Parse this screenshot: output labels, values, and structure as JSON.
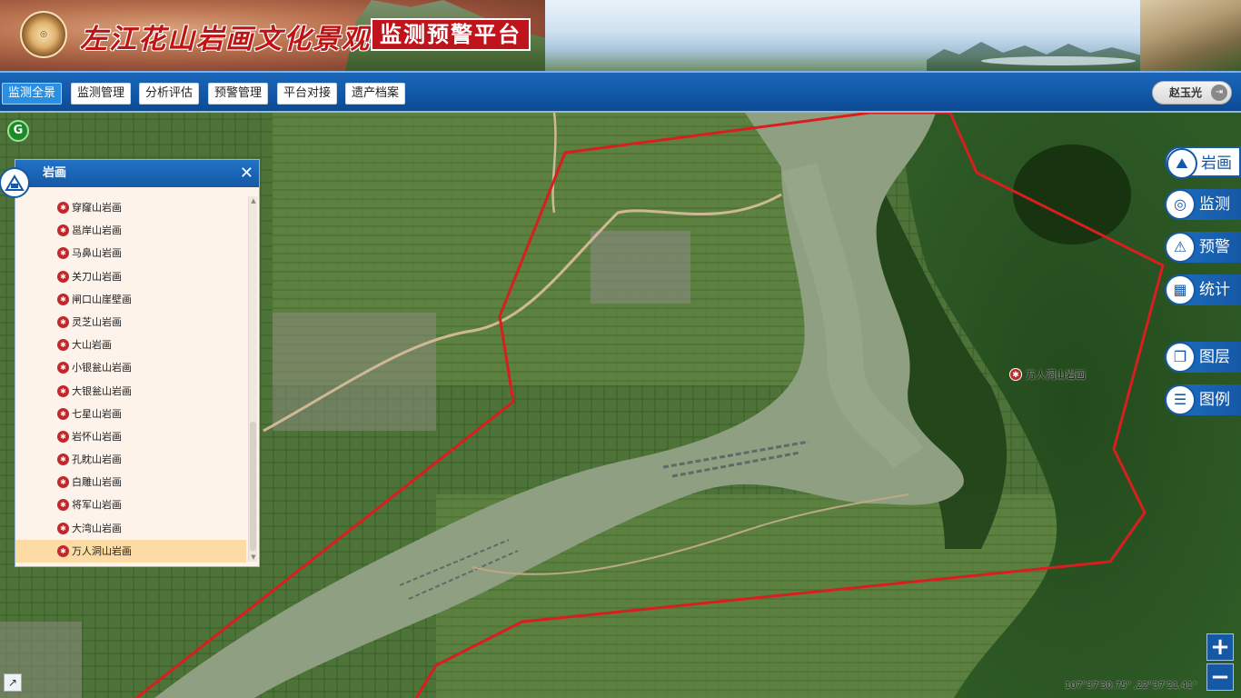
{
  "header": {
    "site_title": "左江花山岩画文化景观",
    "platform_title": "监测预警平台"
  },
  "nav": {
    "items": [
      "监测全景",
      "监测管理",
      "分析评估",
      "预警管理",
      "平台对接",
      "遗产档案"
    ],
    "active": "监测全景",
    "user_name": "赵玉光"
  },
  "panel": {
    "title": "岩画",
    "close_label": "✕",
    "items": [
      {
        "name": "穿窿山岩画"
      },
      {
        "name": "邕岸山岩画"
      },
      {
        "name": "马鼻山岩画"
      },
      {
        "name": "关刀山岩画"
      },
      {
        "name": "闸口山崖壁画"
      },
      {
        "name": "灵芝山岩画"
      },
      {
        "name": "大山岩画"
      },
      {
        "name": "小银瓮山岩画"
      },
      {
        "name": "大银瓮山岩画"
      },
      {
        "name": "七星山岩画"
      },
      {
        "name": "岩怀山岩画"
      },
      {
        "name": "孔眈山岩画"
      },
      {
        "name": "白雕山岩画"
      },
      {
        "name": "将军山岩画"
      },
      {
        "name": "大湾山岩画"
      },
      {
        "name": "万人洞山岩画"
      }
    ],
    "selected": "万人洞山岩画"
  },
  "tools": [
    {
      "label": "岩画",
      "icon": "rock-painting-icon"
    },
    {
      "label": "监测",
      "icon": "radar-icon"
    },
    {
      "label": "预警",
      "icon": "alarm-icon"
    },
    {
      "label": "统计",
      "icon": "chart-icon"
    },
    {
      "label": "图层",
      "icon": "layers-icon"
    },
    {
      "label": "图例",
      "icon": "legend-icon"
    }
  ],
  "map": {
    "marker_label": "万人洞山岩画",
    "coordinates": "107°37'30.75\" ,22°37'21.41\"",
    "zoom_in": "+",
    "zoom_out": "−",
    "g_badge": "G"
  },
  "colors": {
    "nav_blue": "#1558a6",
    "title_red": "#c01414",
    "boundary_red": "#d81e1e",
    "selected_row": "#fcdca4"
  }
}
